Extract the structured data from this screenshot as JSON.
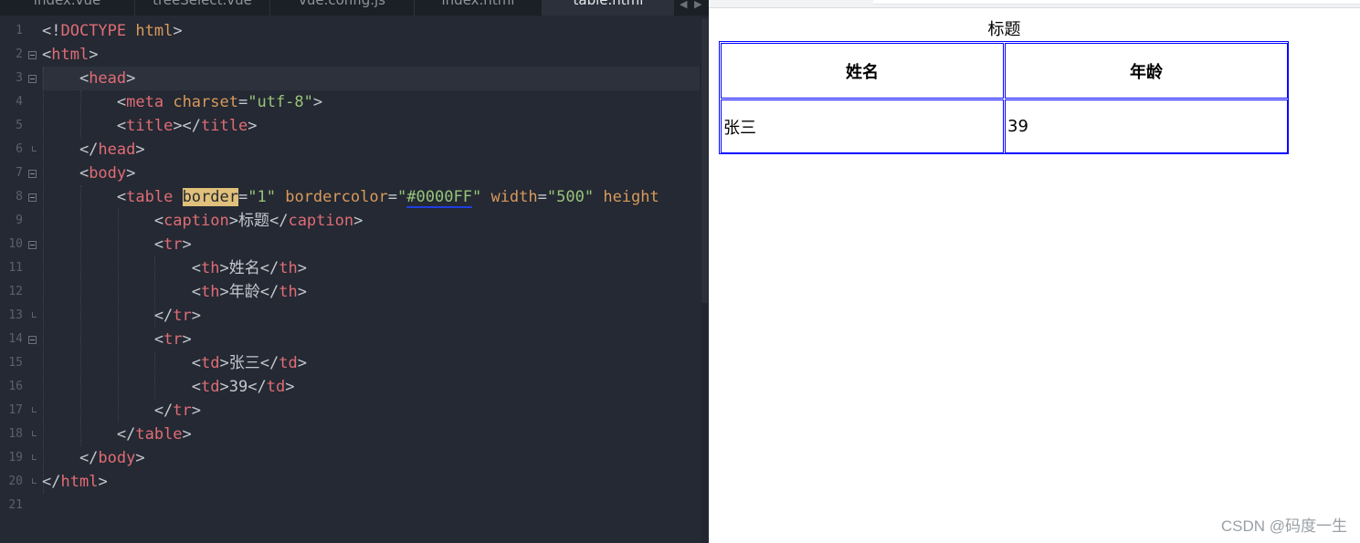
{
  "editor": {
    "tabs": [
      {
        "label": "index.vue",
        "active": false
      },
      {
        "label": "treeSelect.vue",
        "active": false
      },
      {
        "label": "vue.config.js",
        "active": false
      },
      {
        "label": "index.html",
        "active": false
      },
      {
        "label": "table.html",
        "active": true
      }
    ],
    "tab_arrow_left": "◀",
    "tab_arrow_right": "▶",
    "line_numbers": [
      "1",
      "2",
      "3",
      "4",
      "5",
      "6",
      "7",
      "8",
      "9",
      "10",
      "11",
      "12",
      "13",
      "14",
      "15",
      "16",
      "17",
      "18",
      "19",
      "20",
      "21"
    ],
    "code": [
      [
        {
          "t": "<!",
          "c": "p"
        },
        {
          "t": "DOCTYPE",
          "c": "tg"
        },
        {
          "t": " ",
          "c": "p"
        },
        {
          "t": "html",
          "c": "at"
        },
        {
          "t": ">",
          "c": "p"
        }
      ],
      [
        {
          "t": "<",
          "c": "p"
        },
        {
          "t": "html",
          "c": "tg"
        },
        {
          "t": ">",
          "c": "p"
        }
      ],
      [
        {
          "t": "    <",
          "c": "p"
        },
        {
          "t": "head",
          "c": "tg"
        },
        {
          "t": ">",
          "c": "p"
        }
      ],
      [
        {
          "t": "        <",
          "c": "p"
        },
        {
          "t": "meta",
          "c": "tg"
        },
        {
          "t": " ",
          "c": "p"
        },
        {
          "t": "charset",
          "c": "at"
        },
        {
          "t": "=",
          "c": "p"
        },
        {
          "t": "\"utf-8\"",
          "c": "st"
        },
        {
          "t": ">",
          "c": "p"
        }
      ],
      [
        {
          "t": "        <",
          "c": "p"
        },
        {
          "t": "title",
          "c": "tg"
        },
        {
          "t": "></",
          "c": "p"
        },
        {
          "t": "title",
          "c": "tg"
        },
        {
          "t": ">",
          "c": "p"
        }
      ],
      [
        {
          "t": "    </",
          "c": "p"
        },
        {
          "t": "head",
          "c": "tg"
        },
        {
          "t": ">",
          "c": "p"
        }
      ],
      [
        {
          "t": "    <",
          "c": "p"
        },
        {
          "t": "body",
          "c": "tg"
        },
        {
          "t": ">",
          "c": "p"
        }
      ],
      [
        {
          "t": "        <",
          "c": "p"
        },
        {
          "t": "table",
          "c": "tg"
        },
        {
          "t": " ",
          "c": "p"
        },
        {
          "t": "border",
          "c": "hl"
        },
        {
          "t": "=",
          "c": "p"
        },
        {
          "t": "\"1\"",
          "c": "st"
        },
        {
          "t": " ",
          "c": "p"
        },
        {
          "t": "bordercolor",
          "c": "at"
        },
        {
          "t": "=",
          "c": "p"
        },
        {
          "t": "\"",
          "c": "st"
        },
        {
          "t": "#0000FF",
          "c": "st ul"
        },
        {
          "t": "\"",
          "c": "st"
        },
        {
          "t": " ",
          "c": "p"
        },
        {
          "t": "width",
          "c": "at"
        },
        {
          "t": "=",
          "c": "p"
        },
        {
          "t": "\"500\"",
          "c": "st"
        },
        {
          "t": " ",
          "c": "p"
        },
        {
          "t": "height",
          "c": "at"
        }
      ],
      [
        {
          "t": "            <",
          "c": "p"
        },
        {
          "t": "caption",
          "c": "tg"
        },
        {
          "t": ">",
          "c": "p"
        },
        {
          "t": "标题",
          "c": "tx"
        },
        {
          "t": "</",
          "c": "p"
        },
        {
          "t": "caption",
          "c": "tg"
        },
        {
          "t": ">",
          "c": "p"
        }
      ],
      [
        {
          "t": "            <",
          "c": "p"
        },
        {
          "t": "tr",
          "c": "tg"
        },
        {
          "t": ">",
          "c": "p"
        }
      ],
      [
        {
          "t": "                <",
          "c": "p"
        },
        {
          "t": "th",
          "c": "tg"
        },
        {
          "t": ">",
          "c": "p"
        },
        {
          "t": "姓名",
          "c": "tx"
        },
        {
          "t": "</",
          "c": "p"
        },
        {
          "t": "th",
          "c": "tg"
        },
        {
          "t": ">",
          "c": "p"
        }
      ],
      [
        {
          "t": "                <",
          "c": "p"
        },
        {
          "t": "th",
          "c": "tg"
        },
        {
          "t": ">",
          "c": "p"
        },
        {
          "t": "年龄",
          "c": "tx"
        },
        {
          "t": "</",
          "c": "p"
        },
        {
          "t": "th",
          "c": "tg"
        },
        {
          "t": ">",
          "c": "p"
        }
      ],
      [
        {
          "t": "            </",
          "c": "p"
        },
        {
          "t": "tr",
          "c": "tg"
        },
        {
          "t": ">",
          "c": "p"
        }
      ],
      [
        {
          "t": "            <",
          "c": "p"
        },
        {
          "t": "tr",
          "c": "tg"
        },
        {
          "t": ">",
          "c": "p"
        }
      ],
      [
        {
          "t": "                <",
          "c": "p"
        },
        {
          "t": "td",
          "c": "tg"
        },
        {
          "t": ">",
          "c": "p"
        },
        {
          "t": "张三",
          "c": "tx"
        },
        {
          "t": "</",
          "c": "p"
        },
        {
          "t": "td",
          "c": "tg"
        },
        {
          "t": ">",
          "c": "p"
        }
      ],
      [
        {
          "t": "                <",
          "c": "p"
        },
        {
          "t": "td",
          "c": "tg"
        },
        {
          "t": ">",
          "c": "p"
        },
        {
          "t": "39",
          "c": "tx"
        },
        {
          "t": "</",
          "c": "p"
        },
        {
          "t": "td",
          "c": "tg"
        },
        {
          "t": ">",
          "c": "p"
        }
      ],
      [
        {
          "t": "            </",
          "c": "p"
        },
        {
          "t": "tr",
          "c": "tg"
        },
        {
          "t": ">",
          "c": "p"
        }
      ],
      [
        {
          "t": "        </",
          "c": "p"
        },
        {
          "t": "table",
          "c": "tg"
        },
        {
          "t": ">",
          "c": "p"
        }
      ],
      [
        {
          "t": "    </",
          "c": "p"
        },
        {
          "t": "body",
          "c": "tg"
        },
        {
          "t": ">",
          "c": "p"
        }
      ],
      [
        {
          "t": "</",
          "c": "p"
        },
        {
          "t": "html",
          "c": "tg"
        },
        {
          "t": ">",
          "c": "p"
        }
      ],
      []
    ]
  },
  "preview": {
    "caption": "标题",
    "headers": [
      "姓名",
      "年龄"
    ],
    "rows": [
      [
        "张三",
        "39"
      ]
    ],
    "border_color": "#0000FF"
  },
  "watermark": "CSDN @码度一生"
}
